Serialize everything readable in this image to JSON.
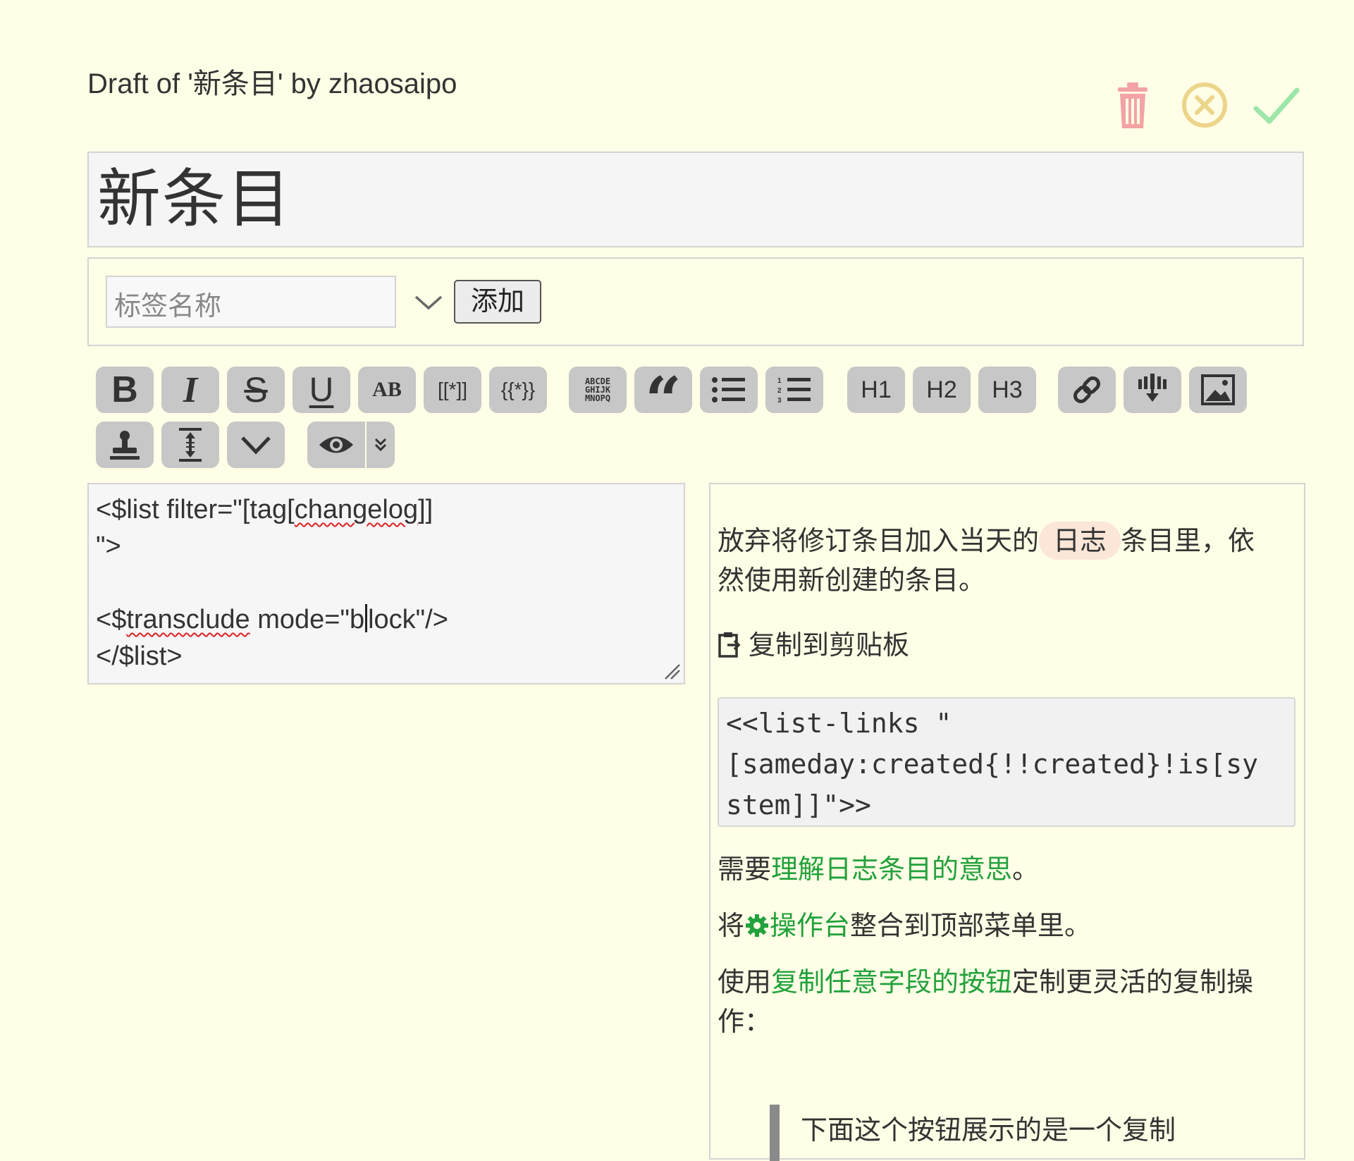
{
  "header": {
    "draft_title": "Draft of '新条目' by zhaosaipo",
    "actions": [
      {
        "name": "delete",
        "icon": "trash-icon",
        "color": "#f3a3a3"
      },
      {
        "name": "cancel",
        "icon": "close-circle-icon",
        "color": "#ecd48a"
      },
      {
        "name": "confirm",
        "icon": "checkmark-icon",
        "color": "#9be6a8"
      }
    ]
  },
  "title_field": {
    "value": "新条目"
  },
  "tags": {
    "placeholder": "标签名称",
    "add_label": "添加"
  },
  "toolbar": {
    "row1": [
      {
        "name": "bold",
        "label": "B"
      },
      {
        "name": "italic",
        "label": "I"
      },
      {
        "name": "strikethrough",
        "label": "S"
      },
      {
        "name": "underline",
        "label": "U"
      },
      {
        "name": "small-caps",
        "label": "AB"
      },
      {
        "name": "wikilink",
        "label": "[[*]]"
      },
      {
        "name": "transclude",
        "label": "{{*}}"
      },
      {
        "name": "monospace",
        "label": "ABCDE GHIJK MNOPQ"
      },
      {
        "name": "quote",
        "label": "“"
      },
      {
        "name": "bullet-list",
        "label": ""
      },
      {
        "name": "numbered-list",
        "label": ""
      },
      {
        "name": "heading-1",
        "label": "H1"
      },
      {
        "name": "heading-2",
        "label": "H2"
      },
      {
        "name": "heading-3",
        "label": "H3"
      },
      {
        "name": "link",
        "label": ""
      },
      {
        "name": "excise",
        "label": ""
      },
      {
        "name": "picture",
        "label": ""
      }
    ],
    "row2": [
      {
        "name": "stamp",
        "label": ""
      },
      {
        "name": "size",
        "label": ""
      },
      {
        "name": "more",
        "label": ""
      },
      {
        "name": "preview",
        "label": ""
      },
      {
        "name": "preview-type",
        "label": ""
      }
    ]
  },
  "editor": {
    "lines": [
      "<$list filter=\"[tag[changelog]]",
      "\">",
      "",
      "<$transclude mode=\"block\"/>",
      "</$list>"
    ],
    "line1_a": "<$list filter=\"[tag[",
    "line1_b": "changelog",
    "line1_c": "]]",
    "line4_a": "<$",
    "line4_b": "transclude",
    "line4_c": " mode=\"b",
    "line4_d": "lock\"/>"
  },
  "preview": {
    "para1_a": "放弃将修订条目加入当天的",
    "para1_pill": "日志",
    "para1_b": "条目里，依",
    "para1_c": "然使用新创建的条目。",
    "copy_label": "复制到剪贴板",
    "code": "<<list-links \"\n[sameday:created{!!created}!is[sy\nstem]]\">>",
    "para2_a": "需要",
    "para2_link": "理解日志条目的意思",
    "para2_b": "。",
    "para3_a": "将",
    "para3_link": "操作台",
    "para3_b": "整合到顶部菜单里。",
    "para4_a": "使用",
    "para4_link": "复制任意字段的按钮",
    "para4_b": "定制更灵活的复制操",
    "para4_c": "作：",
    "quote": "下面这个按钮展示的是一个复制"
  },
  "colors": {
    "background": "#fffee6",
    "link_green": "#22a13c",
    "button_gray": "#c7c7c7"
  }
}
